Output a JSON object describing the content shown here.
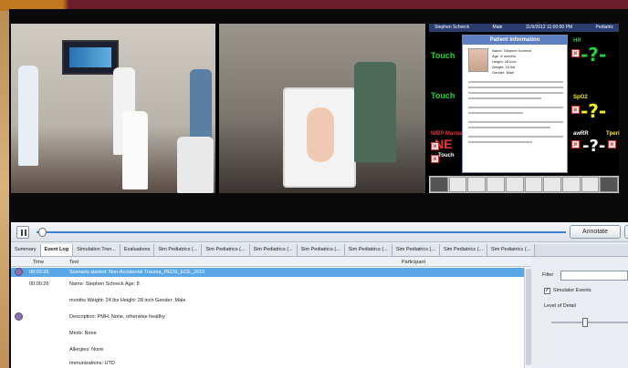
{
  "patient_monitor": {
    "header": [
      "Stephen Schreck",
      "Male",
      "11/9/2012 11:00:00 PM",
      "Pediatric"
    ],
    "popup": {
      "title": "Patient Information",
      "fields": [
        {
          "label": "Name",
          "value": "Stephen Schreck"
        },
        {
          "label": "Age",
          "value": "8 months"
        },
        {
          "label": "Height",
          "value": "28 inch"
        },
        {
          "label": "Weight",
          "value": "24 lbs"
        },
        {
          "label": "Gender",
          "value": "Male"
        }
      ]
    },
    "values": {
      "hr": "-?-",
      "spo2": "-?-",
      "rr": "-?-"
    },
    "labels": {
      "hr": "HR",
      "spo2": "SpO2",
      "awrr": "awRR",
      "tperi": "Tperi",
      "nibp": "NIBP Manual",
      "touch1": "Touch",
      "touch2": "Touch",
      "ne": "NE",
      "touch3": "Touch"
    }
  },
  "controls": {
    "annotate_label": "Annotate",
    "playback_progress": 0.0
  },
  "tabs": [
    {
      "label": "Summary",
      "active": false
    },
    {
      "label": "Event Log",
      "active": true
    },
    {
      "label": "Simulation Tren...",
      "active": false
    },
    {
      "label": "Evaluations",
      "active": false
    },
    {
      "label": "Sim Pediatrics (...",
      "active": false
    },
    {
      "label": "Sim Pediatrics (...",
      "active": false
    },
    {
      "label": "Sim Pediatrics (...",
      "active": false
    },
    {
      "label": "Sim Pediatrics (...",
      "active": false
    },
    {
      "label": "Sim Pediatrics (...",
      "active": false
    },
    {
      "label": "Sim Pediatrics (...",
      "active": false
    },
    {
      "label": "Sim Pediatrics (...",
      "active": false
    },
    {
      "label": "Sim Pediatrics (...",
      "active": false
    }
  ],
  "event_log": {
    "columns": {
      "time": "Time",
      "text": "Text",
      "participant": "Participant"
    },
    "rows": [
      {
        "time": "00:00:26",
        "text": "Scenario started: Non-Accidental Trauma_PEDS_ECE_2010",
        "selected": true
      },
      {
        "time": "00:00:26",
        "text": "Name: Stephen Schreck Age: 8",
        "selected": false
      },
      {
        "time": "",
        "text": "months Weight: 24 lbs Height: 28 inch Gender: Male",
        "selected": false
      },
      {
        "time": "",
        "text": "Description: PMH: None, otherwise healthy",
        "selected": false
      },
      {
        "time": "",
        "text": "Meds: None",
        "selected": false
      },
      {
        "time": "",
        "text": "Allergies: None",
        "selected": false
      },
      {
        "time": "",
        "text": "Immunizations: UTD",
        "selected": false
      }
    ]
  },
  "side_panel": {
    "filter_label": "Filter",
    "simulator_events_label": "Simulator Events",
    "simulator_events_checked": true,
    "level_of_detail_label": "Level of Detail",
    "level_of_detail_value": 0.4
  }
}
